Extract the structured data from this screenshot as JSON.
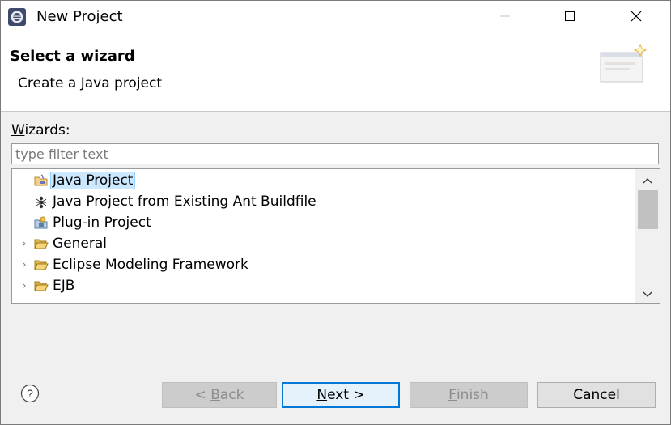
{
  "window": {
    "title": "New Project",
    "controls": {
      "minimize_icon": "minimize-icon",
      "maximize_icon": "maximize-icon",
      "close_icon": "close-icon"
    }
  },
  "banner": {
    "title": "Select a wizard",
    "description": "Create a Java project",
    "graphic_icon": "wizard-banner-icon"
  },
  "wizards": {
    "label_prefix": "W",
    "label_rest": "izards:",
    "filter_placeholder": "type filter text",
    "filter_value": "",
    "items": [
      {
        "label": "Java Project",
        "icon": "java-project-icon",
        "selected": true,
        "expandable": false
      },
      {
        "label": "Java Project from Existing Ant Buildfile",
        "icon": "ant-icon",
        "selected": false,
        "expandable": false
      },
      {
        "label": "Plug-in Project",
        "icon": "plugin-project-icon",
        "selected": false,
        "expandable": false
      },
      {
        "label": "General",
        "icon": "folder-icon",
        "selected": false,
        "expandable": true
      },
      {
        "label": "Eclipse Modeling Framework",
        "icon": "folder-icon",
        "selected": false,
        "expandable": true
      },
      {
        "label": "EJB",
        "icon": "folder-icon",
        "selected": false,
        "expandable": true
      }
    ]
  },
  "buttons": {
    "back_prefix": "< ",
    "back_mnemonic": "B",
    "back_rest": "ack",
    "next_mnemonic": "N",
    "next_rest": "ext >",
    "finish_mnemonic": "F",
    "finish_rest": "inish",
    "cancel": "Cancel",
    "help_icon": "help-icon"
  },
  "colors": {
    "selection_bg": "#cce8ff",
    "default_button_border": "#0078d7",
    "dialog_bg": "#f0f0f0"
  }
}
